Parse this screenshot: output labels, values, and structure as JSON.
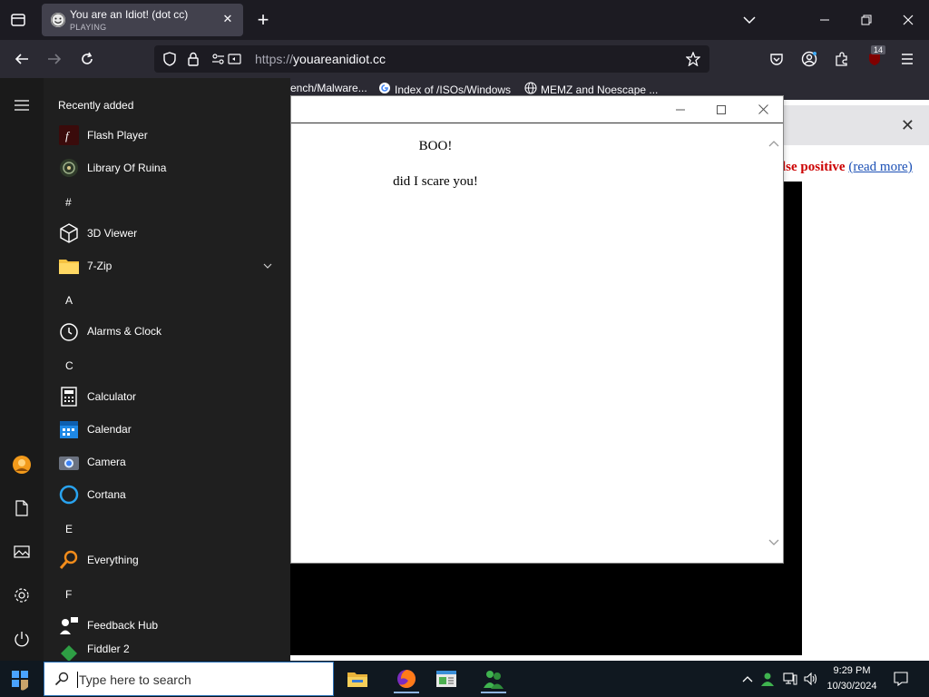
{
  "browser": {
    "tab": {
      "title": "You are an Idiot! (dot cc)",
      "status": "PLAYING",
      "close_glyph": "✕"
    },
    "new_tab_glyph": "+",
    "url": {
      "protocol": "https://",
      "host": "youareanidiot.cc"
    },
    "extension_badge": "14",
    "bookmarks": [
      {
        "label": "ench/Malware...",
        "icon": "none"
      },
      {
        "label": "Index of /ISOs/Windows",
        "icon": "google-icon"
      },
      {
        "label": "MEMZ and Noescape ...",
        "icon": "globe-icon"
      }
    ]
  },
  "page": {
    "false_positive": {
      "bold_text": "lse positive",
      "link_text": "(read more)"
    },
    "notice_close_glyph": "✕"
  },
  "popup": {
    "boo_text": "BOO!",
    "scare_text": "did I scare you!"
  },
  "start_menu": {
    "heading": "Recently added",
    "entries": [
      {
        "kind": "item",
        "label": "Flash Player",
        "icon": "flash-icon"
      },
      {
        "kind": "item",
        "label": "Library Of Ruina",
        "icon": "game-icon"
      },
      {
        "kind": "letter",
        "label": "#"
      },
      {
        "kind": "item",
        "label": "3D Viewer",
        "icon": "cube-icon"
      },
      {
        "kind": "item",
        "label": "7-Zip",
        "icon": "folder-icon",
        "expandable": true
      },
      {
        "kind": "letter",
        "label": "A"
      },
      {
        "kind": "item",
        "label": "Alarms & Clock",
        "icon": "clock-icon"
      },
      {
        "kind": "letter",
        "label": "C"
      },
      {
        "kind": "item",
        "label": "Calculator",
        "icon": "calculator-icon"
      },
      {
        "kind": "item",
        "label": "Calendar",
        "icon": "calendar-icon"
      },
      {
        "kind": "item",
        "label": "Camera",
        "icon": "camera-icon"
      },
      {
        "kind": "item",
        "label": "Cortana",
        "icon": "cortana-icon"
      },
      {
        "kind": "letter",
        "label": "E"
      },
      {
        "kind": "item",
        "label": "Everything",
        "icon": "magnifier-icon"
      },
      {
        "kind": "letter",
        "label": "F"
      },
      {
        "kind": "item",
        "label": "Feedback Hub",
        "icon": "feedback-icon"
      },
      {
        "kind": "item",
        "label": "Fiddler 2",
        "icon": "fiddler-icon"
      }
    ],
    "rail_icons": [
      "hamburger-icon",
      "user-avatar-icon",
      "documents-icon",
      "pictures-icon",
      "settings-icon",
      "power-icon"
    ]
  },
  "taskbar": {
    "search_placeholder": "Type here to search",
    "clock": {
      "time": "9:29 PM",
      "date": "10/30/2024"
    },
    "apps": [
      "file-explorer-icon",
      "firefox-icon",
      "news-icon",
      "messenger-icon"
    ]
  },
  "colors": {
    "tabbar_bg": "#1c1b22",
    "navbar_bg": "#2b2a33",
    "start_bg": "#1f1f1f",
    "taskbar_bg": "#101820",
    "false_positive_red": "#cc0000",
    "link_blue": "#1a4fb5"
  }
}
